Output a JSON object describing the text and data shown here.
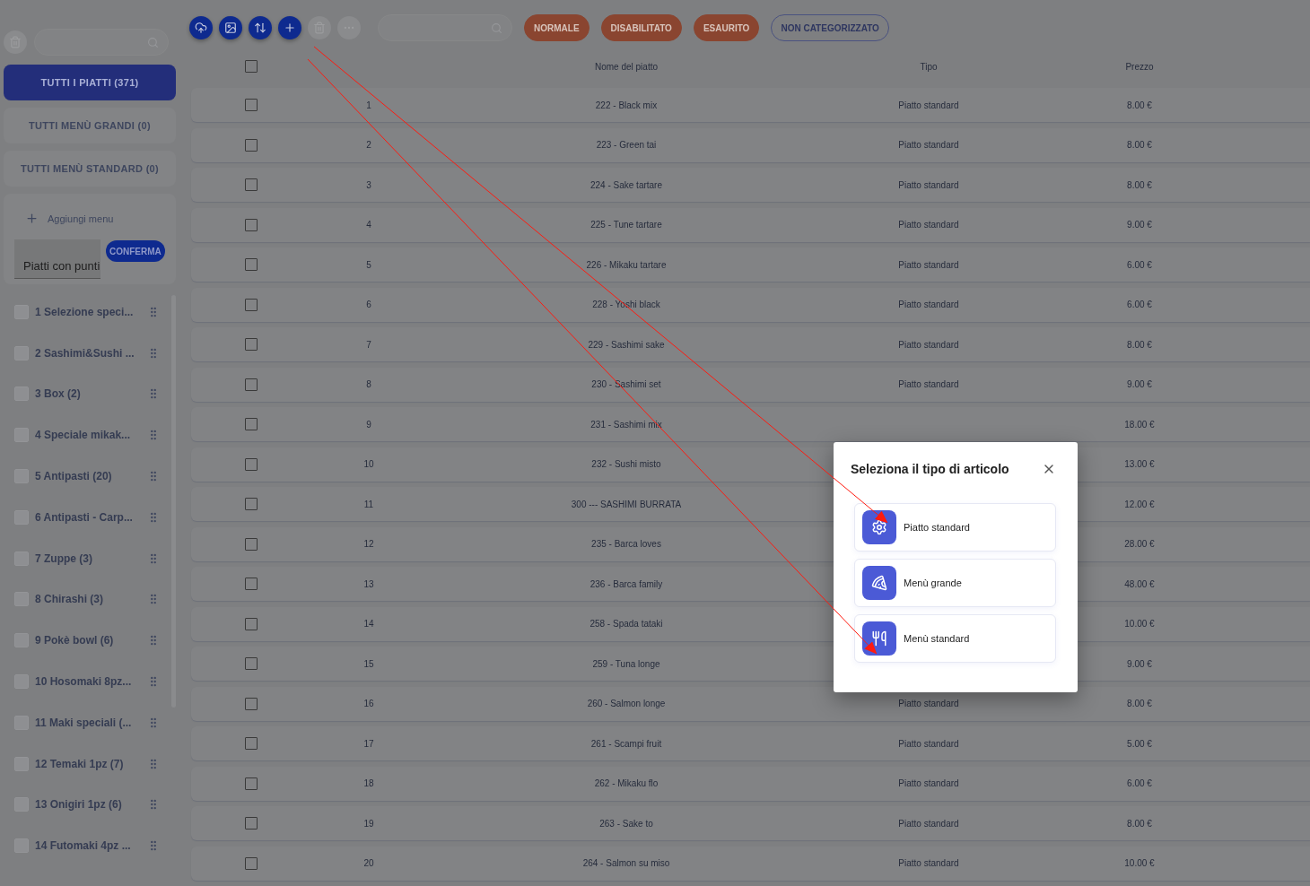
{
  "toolbar": {
    "buttons": [
      {
        "kind": "upload",
        "disabled": false
      },
      {
        "kind": "image",
        "disabled": false
      },
      {
        "kind": "sort",
        "disabled": false
      },
      {
        "kind": "add",
        "disabled": false
      },
      {
        "kind": "delete",
        "disabled": true
      },
      {
        "kind": "more",
        "disabled": true
      }
    ]
  },
  "filters": [
    {
      "label": "NORMALE",
      "selected": true
    },
    {
      "label": "DISABILITATO",
      "selected": true
    },
    {
      "label": "ESAURITO",
      "selected": true
    },
    {
      "label": "NON CATEGORIZZATO",
      "selected": false
    }
  ],
  "sidebar": {
    "tabs": [
      {
        "label": "TUTTI I PIATTI (371)",
        "selected": true
      },
      {
        "label": "TUTTI MENÙ GRANDI (0)",
        "selected": false
      },
      {
        "label": "TUTTI MENÙ STANDARD (0)",
        "selected": false
      }
    ],
    "add_menu": "Aggiungi menu",
    "new_menu_value": "Piatti con punti",
    "confirm": "CONFERMA",
    "categories": [
      {
        "label": "1 Selezione speci...",
        "checked": false
      },
      {
        "label": "2 Sashimi&Sushi ...",
        "checked": false
      },
      {
        "label": "3 Box (2)",
        "checked": false
      },
      {
        "label": "4 Speciale mikak...",
        "checked": false
      },
      {
        "label": "5 Antipasti (20)",
        "checked": false
      },
      {
        "label": "6 Antipasti - Carp...",
        "checked": false
      },
      {
        "label": "7 Zuppe (3)",
        "checked": false
      },
      {
        "label": "8 Chirashi (3)",
        "checked": false
      },
      {
        "label": "9 Pokè bowl (6)",
        "checked": false
      },
      {
        "label": "10 Hosomaki 8pz...",
        "checked": false
      },
      {
        "label": "11 Maki speciali (...",
        "checked": false
      },
      {
        "label": "12 Temaki 1pz (7)",
        "checked": false
      },
      {
        "label": "13 Onigiri 1pz (6)",
        "checked": false
      },
      {
        "label": "14 Futomaki 4pz ...",
        "checked": false
      }
    ]
  },
  "table": {
    "select_all_checked": false,
    "columns": [
      "Nome del piatto",
      "Tipo",
      "Prezzo"
    ],
    "rows": [
      {
        "n": "1",
        "name": "222 - Black mix",
        "type": "Piatto standard",
        "price": "8.00 €",
        "checked": false
      },
      {
        "n": "2",
        "name": "223 - Green tai",
        "type": "Piatto standard",
        "price": "8.00 €",
        "checked": false
      },
      {
        "n": "3",
        "name": "224 - Sake tartare",
        "type": "Piatto standard",
        "price": "8.00 €",
        "checked": false
      },
      {
        "n": "4",
        "name": "225 - Tune tartare",
        "type": "Piatto standard",
        "price": "9.00 €",
        "checked": false
      },
      {
        "n": "5",
        "name": "226 - Mikaku tartare",
        "type": "Piatto standard",
        "price": "6.00 €",
        "checked": false
      },
      {
        "n": "6",
        "name": "228 - Yoshi black",
        "type": "Piatto standard",
        "price": "6.00 €",
        "checked": false
      },
      {
        "n": "7",
        "name": "229 - Sashimi sake",
        "type": "Piatto standard",
        "price": "8.00 €",
        "checked": false
      },
      {
        "n": "8",
        "name": "230 - Sashimi set",
        "type": "Piatto standard",
        "price": "9.00 €",
        "checked": false
      },
      {
        "n": "9",
        "name": "231 - Sashimi mix",
        "price": "18.00 €",
        "checked": false
      },
      {
        "n": "10",
        "name": "232 - Sushi misto",
        "price": "13.00 €",
        "checked": false
      },
      {
        "n": "11",
        "name": "300 --- SASHIMI BURRATA",
        "price": "12.00 €",
        "checked": false
      },
      {
        "n": "12",
        "name": "235 - Barca loves",
        "price": "28.00 €",
        "checked": false
      },
      {
        "n": "13",
        "name": "236 - Barca family",
        "price": "48.00 €",
        "checked": false
      },
      {
        "n": "14",
        "name": "258 - Spada tataki",
        "price": "10.00 €",
        "checked": false
      },
      {
        "n": "15",
        "name": "259 - Tuna longe",
        "price": "9.00 €",
        "checked": false
      },
      {
        "n": "16",
        "name": "260 - Salmon longe",
        "type": "Piatto standard",
        "price": "8.00 €",
        "checked": false
      },
      {
        "n": "17",
        "name": "261 - Scampi fruit",
        "type": "Piatto standard",
        "price": "5.00 €",
        "checked": false
      },
      {
        "n": "18",
        "name": "262 - Mikaku flo",
        "type": "Piatto standard",
        "price": "6.00 €",
        "checked": false
      },
      {
        "n": "19",
        "name": "263 - Sake to",
        "type": "Piatto standard",
        "price": "8.00 €",
        "checked": false
      },
      {
        "n": "20",
        "name": "264 - Salmon su miso",
        "type": "Piatto standard",
        "price": "10.00 €",
        "checked": false
      }
    ]
  },
  "dialog": {
    "title": "Seleziona il tipo di articolo",
    "options": [
      {
        "kind": "dish",
        "label": "Piatto standard"
      },
      {
        "kind": "big_menu",
        "label": "Menù grande"
      },
      {
        "kind": "standard_menu",
        "label": "Menù standard"
      }
    ]
  }
}
